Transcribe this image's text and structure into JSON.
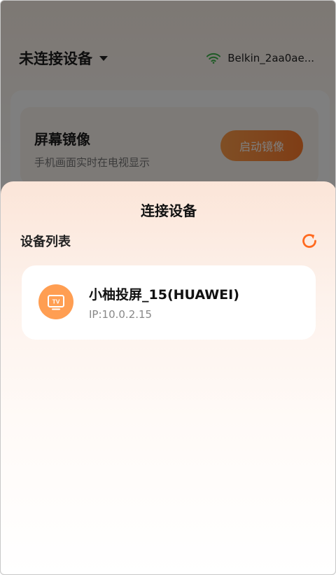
{
  "header": {
    "device_status": "未连接设备",
    "wifi_name": "Belkin_2aa0ae..."
  },
  "mirror": {
    "title": "屏幕镜像",
    "description": "手机画面实时在电视显示",
    "button_label": "启动镜像"
  },
  "sheet": {
    "title": "连接设备",
    "section_label": "设备列表",
    "devices": [
      {
        "name": "小柚投屏_15(HUAWEI)",
        "ip": "IP:10.0.2.15",
        "icon_text": "TV"
      }
    ]
  },
  "colors": {
    "accent": "#ff7b2c",
    "wifi": "#3cb54a",
    "tv_badge": "#ff9e52"
  },
  "icons": [
    "caret-down-icon",
    "wifi-icon",
    "refresh-icon",
    "tv-icon"
  ]
}
